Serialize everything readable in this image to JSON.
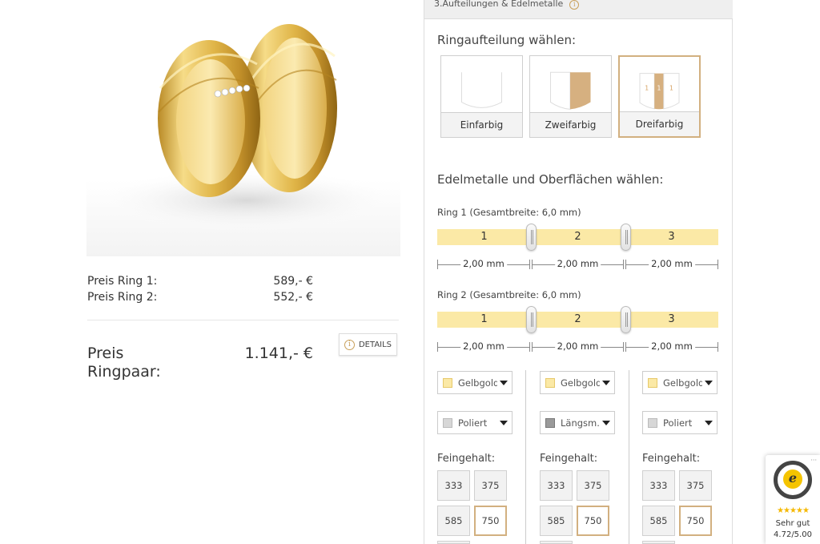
{
  "product": {
    "image_alt": "pair of yellow gold wedding rings"
  },
  "prices": {
    "ring1_label": "Preis Ring 1:",
    "ring1_value": "589,- €",
    "ring2_label": "Preis Ring 2:",
    "ring2_value": "552,- €",
    "total_label": "Preis Ringpaar:",
    "total_value": "1.141,- €",
    "details_label": "DETAILS"
  },
  "panel": {
    "header": "3.Aufteilungen & Edelmetalle",
    "split_title": "Ringaufteilung wählen:",
    "splits": [
      {
        "label": "Einfarbig",
        "active": false
      },
      {
        "label": "Zweifarbig",
        "active": false
      },
      {
        "label": "Dreifarbig",
        "active": true
      }
    ],
    "split_digits": [
      "1",
      "1",
      "1"
    ],
    "metals_title": "Edelmetalle und Oberflächen wählen:",
    "rings": [
      {
        "label": "Ring 1 (Gesamtbreite: 6,0 mm)",
        "segments": [
          "1",
          "2",
          "3"
        ],
        "widths": [
          "2,00 mm",
          "2,00 mm",
          "2,00 mm"
        ]
      },
      {
        "label": "Ring 2 (Gesamtbreite: 6,0 mm)",
        "segments": [
          "1",
          "2",
          "3"
        ],
        "widths": [
          "2,00 mm",
          "2,00 mm",
          "2,00 mm"
        ]
      }
    ],
    "columns": [
      {
        "metal": "Gelbgold",
        "surface": "Poliert",
        "fg_label": "Feingehalt:",
        "fineness": [
          "333",
          "375",
          "585",
          "750"
        ],
        "selected": "750"
      },
      {
        "metal": "Gelbgold",
        "surface": "Längsm...",
        "fg_label": "Feingehalt:",
        "fineness": [
          "333",
          "375",
          "585",
          "750"
        ],
        "selected": "750"
      },
      {
        "metal": "Gelbgold",
        "surface": "Poliert",
        "fg_label": "Feingehalt:",
        "fineness": [
          "333",
          "375",
          "585",
          "750"
        ],
        "selected": "750"
      }
    ]
  },
  "trusted_shops": {
    "stars": "★★★★★",
    "grade": "Sehr gut",
    "score": "4.72/5.00"
  },
  "colors": {
    "accent_gold": "#d2b080",
    "bar_yellow": "#fbe9a6",
    "metal_swatch": "#fbe9a6"
  }
}
